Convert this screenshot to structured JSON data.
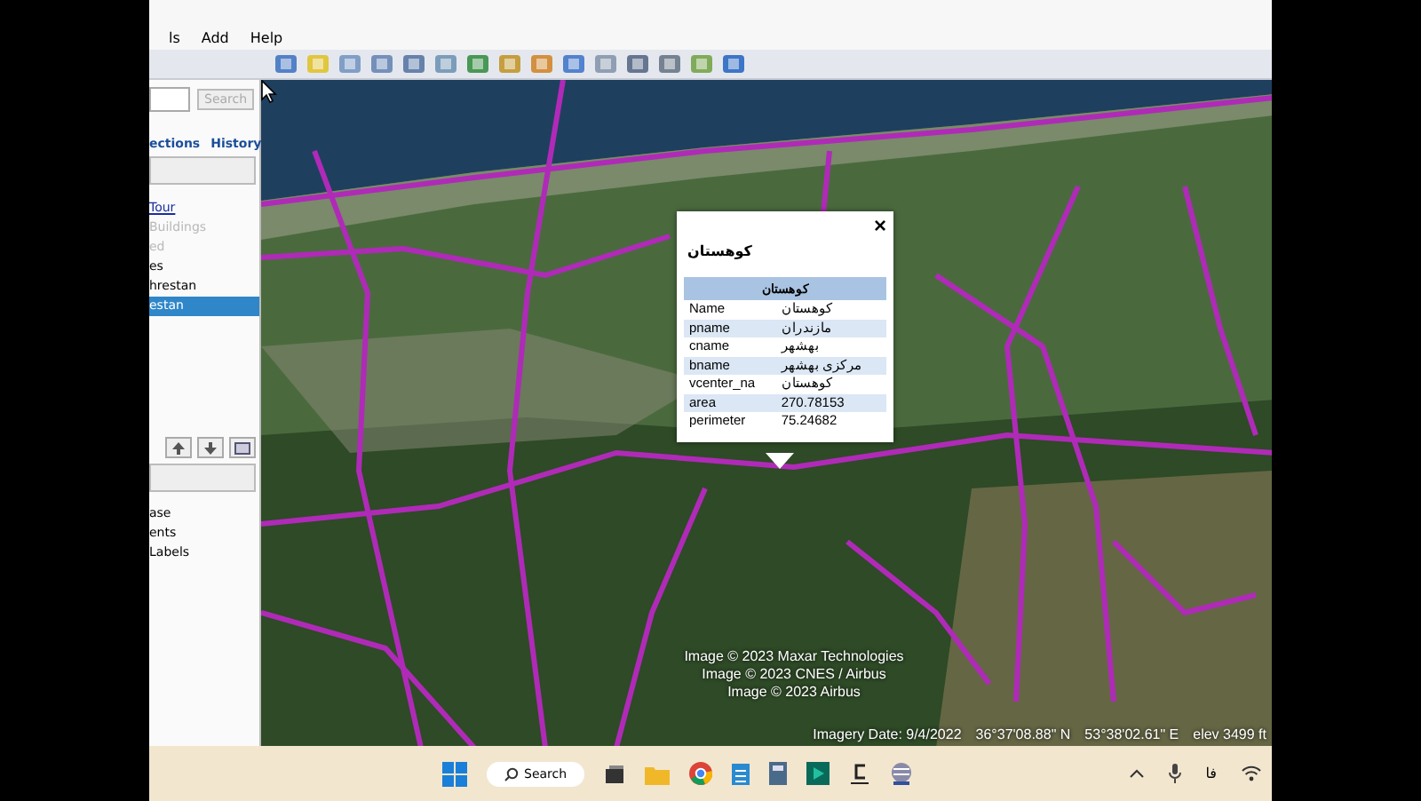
{
  "menu": [
    "ls",
    "Add",
    "Help"
  ],
  "search": {
    "button": "Search"
  },
  "sidebar_links": [
    "ections",
    "History"
  ],
  "places": [
    {
      "label": "Tour",
      "kind": "link",
      "disabled": false,
      "selected": false
    },
    {
      "label": "Buildings",
      "kind": "item",
      "disabled": true,
      "selected": false
    },
    {
      "label": "ed",
      "kind": "item",
      "disabled": true,
      "selected": false
    },
    {
      "label": "es",
      "kind": "item",
      "disabled": false,
      "selected": false
    },
    {
      "label": "hrestan",
      "kind": "item",
      "disabled": false,
      "selected": false
    },
    {
      "label": "estan",
      "kind": "item",
      "disabled": false,
      "selected": true
    }
  ],
  "layers": [
    "ase",
    "ents",
    "Labels"
  ],
  "popup": {
    "close": "×",
    "title": "کوهستان",
    "table_title": "کوهستان",
    "rows": [
      {
        "name": "Name",
        "value": "کوهستان"
      },
      {
        "name": "pname",
        "value": "مازندران"
      },
      {
        "name": "cname",
        "value": "بهشهر"
      },
      {
        "name": "bname",
        "value": "مرکزی بهشهر"
      },
      {
        "name": "vcenter_na",
        "value": "کوهستان"
      },
      {
        "name": "area",
        "value": "270.78153"
      },
      {
        "name": "perimeter",
        "value": "75.24682"
      }
    ]
  },
  "credits": [
    "Image © 2023 Maxar Technologies",
    "Image © 2023 CNES / Airbus",
    "Image © 2023 Airbus"
  ],
  "status": {
    "imagery_date": "Imagery Date: 9/4/2022",
    "lat": "36°37'08.88\" N",
    "lon": "53°38'02.61\" E",
    "elev": "elev  3499 ft"
  },
  "taskbar": {
    "search": "Search",
    "language": "فا"
  }
}
